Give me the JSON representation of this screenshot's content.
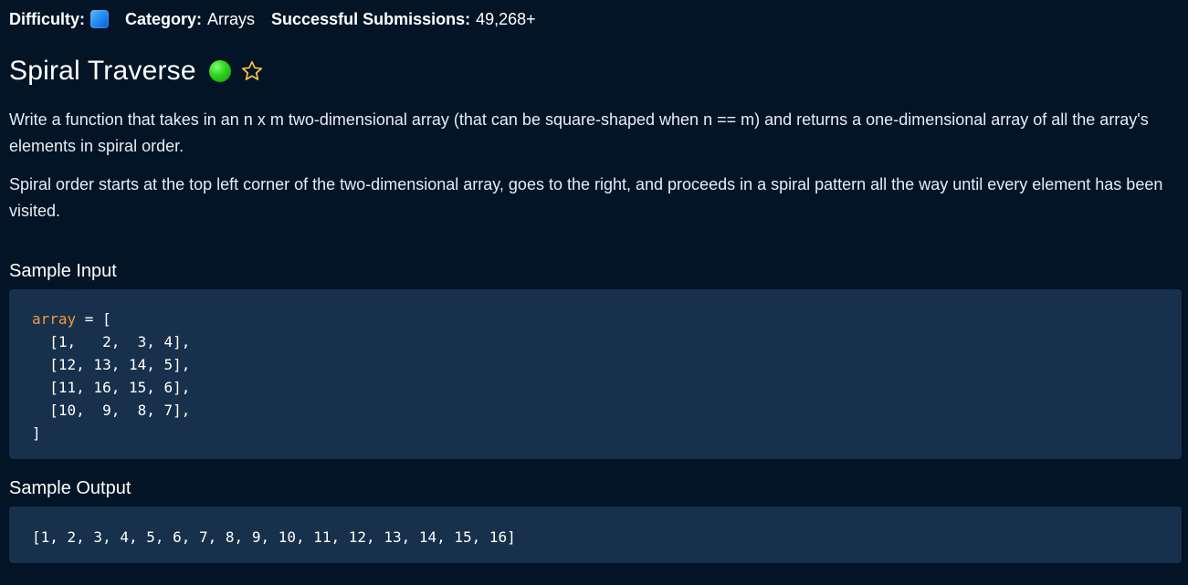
{
  "meta": {
    "difficulty_label": "Difficulty:",
    "category_label": "Category:",
    "category_value": "Arrays",
    "submissions_label": "Successful Submissions:",
    "submissions_value": "49,268+"
  },
  "problem": {
    "title": "Spiral Traverse",
    "paragraphs": [
      "Write a function that takes in an n x m two-dimensional array (that can be square-shaped when n == m) and returns a one-dimensional array of all the array's elements in spiral order.",
      "Spiral order starts at the top left corner of the two-dimensional array, goes to the right, and proceeds in a spiral pattern all the way until every element has been visited."
    ]
  },
  "sample_input": {
    "heading": "Sample Input",
    "var_name": "array",
    "assign": " = [",
    "rows": [
      "  [1,   2,  3, 4],",
      "  [12, 13, 14, 5],",
      "  [11, 16, 15, 6],",
      "  [10,  9,  8, 7],"
    ],
    "closing": "]"
  },
  "sample_output": {
    "heading": "Sample Output",
    "value": "[1, 2, 3, 4, 5, 6, 7, 8, 9, 10, 11, 12, 13, 14, 15, 16]"
  },
  "icons": {
    "difficulty": "difficulty-square-icon",
    "status": "completed-status-icon",
    "favorite": "star-icon"
  },
  "colors": {
    "background": "#031427",
    "code_background": "#17304b",
    "code_variable": "#f39a3e",
    "difficulty_blue": "#1f86ea",
    "status_green": "#2ad11f",
    "star_outline": "#f5c542"
  }
}
